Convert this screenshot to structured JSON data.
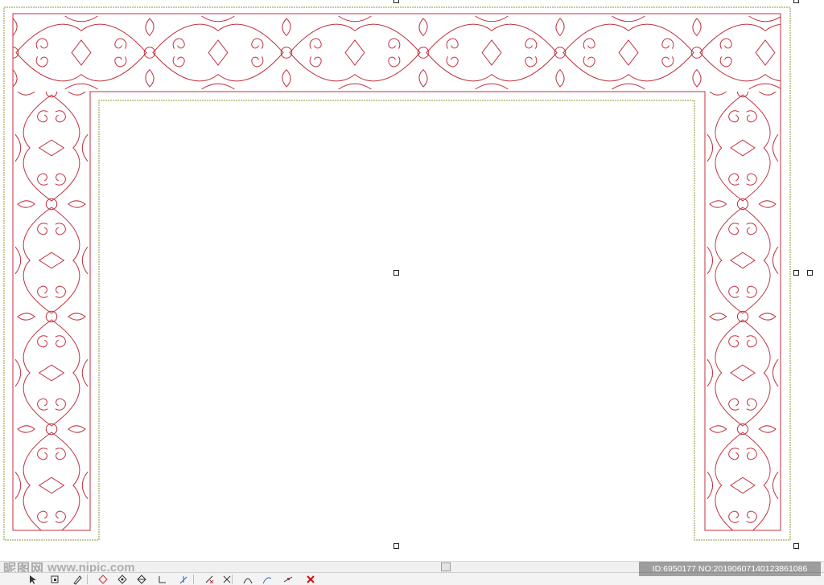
{
  "canvas": {
    "drawing": "ornamental-arch-frame",
    "stroke_color": "#c0303e",
    "bounding_color": "#8a9a3a"
  },
  "toolbar": {
    "tools": [
      {
        "icon": "pointer-icon"
      },
      {
        "icon": "node-select-icon"
      },
      {
        "icon": "pen-icon"
      },
      {
        "icon": "diamond-icon"
      },
      {
        "icon": "diamond-outline-icon"
      },
      {
        "icon": "diamond-split-icon"
      },
      {
        "icon": "corner-icon"
      },
      {
        "icon": "axis-icon"
      },
      {
        "icon": "node-delete-icon"
      },
      {
        "icon": "node-remove-icon"
      },
      {
        "icon": "curve-icon"
      },
      {
        "icon": "curve-edit-icon"
      },
      {
        "icon": "line-cut-icon"
      },
      {
        "icon": "close-icon"
      }
    ]
  },
  "watermark": {
    "logo": "昵图网",
    "url": "www.nipic.com",
    "id_text": "ID:6950177 NO:20190607140123861086"
  }
}
